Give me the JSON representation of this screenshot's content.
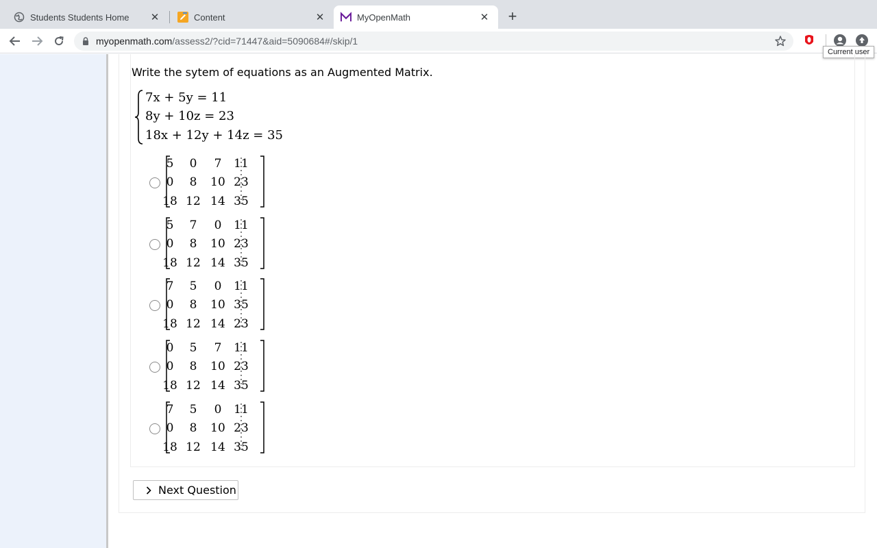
{
  "browser": {
    "tabs": [
      {
        "title": "Students Students Home",
        "icon": "globe-icon"
      },
      {
        "title": "Content",
        "icon": "pencil-icon"
      },
      {
        "title": "MyOpenMath",
        "icon": "myopenmath-m-icon",
        "active": true
      }
    ],
    "url_host": "myopenmath.com",
    "url_path": "/assess2/?cid=71447&aid=5090684#/skip/1",
    "tooltip": "Current user"
  },
  "question": {
    "prompt": "Write the sytem of equations as an Augmented Matrix.",
    "equations": [
      "7x + 5y = 11",
      "8y + 10z = 23",
      "18x + 12y + 14z = 35"
    ],
    "options": [
      {
        "rows": [
          [
            "5",
            "0",
            "7",
            "11"
          ],
          [
            "0",
            "8",
            "10",
            "23"
          ],
          [
            "18",
            "12",
            "14",
            "35"
          ]
        ]
      },
      {
        "rows": [
          [
            "5",
            "7",
            "0",
            "11"
          ],
          [
            "0",
            "8",
            "10",
            "23"
          ],
          [
            "18",
            "12",
            "14",
            "35"
          ]
        ]
      },
      {
        "rows": [
          [
            "7",
            "5",
            "0",
            "11"
          ],
          [
            "0",
            "8",
            "10",
            "35"
          ],
          [
            "18",
            "12",
            "14",
            "23"
          ]
        ]
      },
      {
        "rows": [
          [
            "0",
            "5",
            "7",
            "11"
          ],
          [
            "0",
            "8",
            "10",
            "23"
          ],
          [
            "18",
            "12",
            "14",
            "35"
          ]
        ]
      },
      {
        "rows": [
          [
            "7",
            "5",
            "0",
            "11"
          ],
          [
            "0",
            "8",
            "10",
            "23"
          ],
          [
            "18",
            "12",
            "14",
            "35"
          ]
        ]
      }
    ]
  },
  "next_button": {
    "label": "Next Question"
  },
  "colors": {
    "left_panel": "#ecf2fb",
    "tab_strip": "#dee1e6",
    "omnibox": "#f1f3f4",
    "opera_red": "#e8141c",
    "myopenmath_purple": "#6a1b9a"
  }
}
